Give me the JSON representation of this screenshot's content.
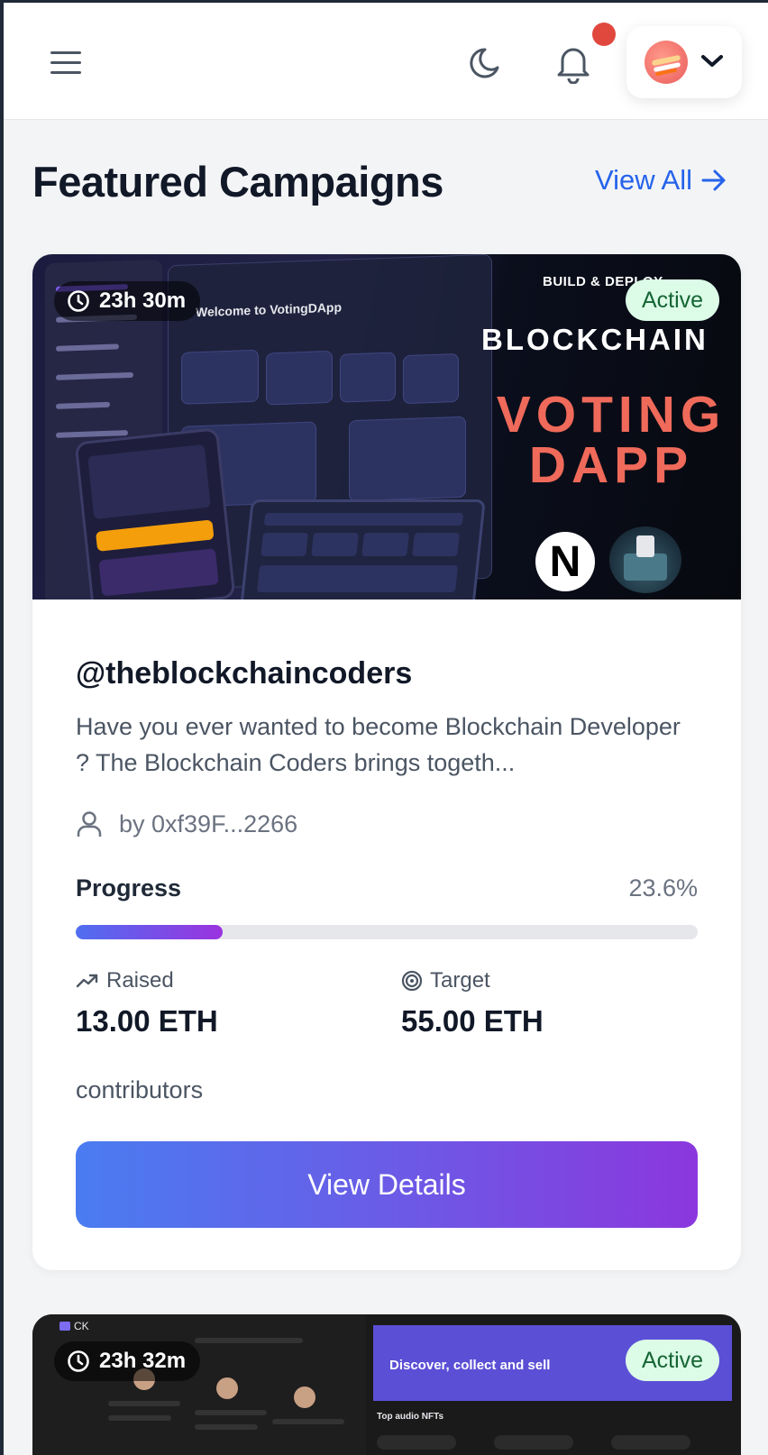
{
  "header": {
    "menu_icon": "hamburger-menu-icon",
    "theme_icon": "moon-icon",
    "notification_icon": "bell-icon",
    "profile_icon": "avatar-sushi",
    "dropdown_icon": "chevron-down-icon",
    "notification_dot_color": "#e0483e"
  },
  "section": {
    "title": "Featured Campaigns",
    "view_all": "View All"
  },
  "campaigns": [
    {
      "timer": "23h 30m",
      "status": "Active",
      "banner": {
        "subtitle": "BUILD & DEPLOY",
        "line1": "BLOCKCHAIN",
        "line2": "VOTING DAPP",
        "logo_letter": "N",
        "screenshot_title": "Welcome to VotingDApp"
      },
      "handle": "@theblockchaincoders",
      "description": "Have you ever wanted to become Blockchain Developer ? The Blockchain Coders brings togeth...",
      "creator": "by 0xf39F...2266",
      "progress_label": "Progress",
      "progress_percent": "23.6%",
      "progress_fraction": 0.236,
      "raised_label": "Raised",
      "raised_value": "13.00 ETH",
      "target_label": "Target",
      "target_value": "55.00 ETH",
      "contributors": "contributors",
      "cta": "View Details"
    },
    {
      "timer": "23h 32m",
      "status": "Active",
      "banner": {
        "brand": "CK",
        "headline": "Discover, collect and sell",
        "section": "Top audio NFTs"
      }
    }
  ],
  "colors": {
    "accent": "#2563eb",
    "progress_start": "#4f6ef0",
    "progress_end": "#9b33e0",
    "active_bg": "#dcfce7",
    "active_text": "#166534",
    "promo_red": "#ef6a5a"
  }
}
